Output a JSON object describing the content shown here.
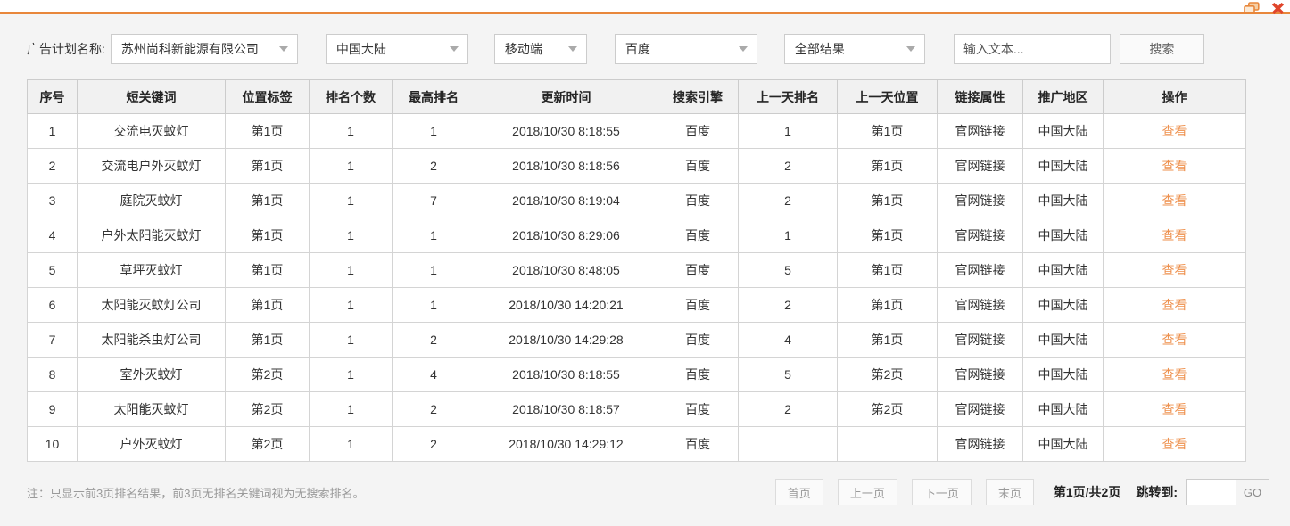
{
  "window": {
    "restore_icon": "restore-window",
    "close_icon": "close-window"
  },
  "filters": {
    "label": "广告计划名称:",
    "dropdowns": [
      "苏州尚科新能源有限公司",
      "中国大陆",
      "移动端",
      "百度",
      "全部结果"
    ],
    "search_input_placeholder": "输入文本...",
    "search_button": "搜索"
  },
  "table": {
    "headers": [
      "序号",
      "短关键词",
      "位置标签",
      "排名个数",
      "最高排名",
      "更新时间",
      "搜索引擎",
      "上一天排名",
      "上一天位置",
      "链接属性",
      "推广地区",
      "操作"
    ],
    "rows": [
      [
        "1",
        "交流电灭蚊灯",
        "第1页",
        "1",
        "1",
        "2018/10/30 8:18:55",
        "百度",
        "1",
        "第1页",
        "官网链接",
        "中国大陆",
        "查看"
      ],
      [
        "2",
        "交流电户外灭蚊灯",
        "第1页",
        "1",
        "2",
        "2018/10/30 8:18:56",
        "百度",
        "2",
        "第1页",
        "官网链接",
        "中国大陆",
        "查看"
      ],
      [
        "3",
        "庭院灭蚊灯",
        "第1页",
        "1",
        "7",
        "2018/10/30 8:19:04",
        "百度",
        "2",
        "第1页",
        "官网链接",
        "中国大陆",
        "查看"
      ],
      [
        "4",
        "户外太阳能灭蚊灯",
        "第1页",
        "1",
        "1",
        "2018/10/30 8:29:06",
        "百度",
        "1",
        "第1页",
        "官网链接",
        "中国大陆",
        "查看"
      ],
      [
        "5",
        "草坪灭蚊灯",
        "第1页",
        "1",
        "1",
        "2018/10/30 8:48:05",
        "百度",
        "5",
        "第1页",
        "官网链接",
        "中国大陆",
        "查看"
      ],
      [
        "6",
        "太阳能灭蚊灯公司",
        "第1页",
        "1",
        "1",
        "2018/10/30 14:20:21",
        "百度",
        "2",
        "第1页",
        "官网链接",
        "中国大陆",
        "查看"
      ],
      [
        "7",
        "太阳能杀虫灯公司",
        "第1页",
        "1",
        "2",
        "2018/10/30 14:29:28",
        "百度",
        "4",
        "第1页",
        "官网链接",
        "中国大陆",
        "查看"
      ],
      [
        "8",
        "室外灭蚊灯",
        "第2页",
        "1",
        "4",
        "2018/10/30 8:18:55",
        "百度",
        "5",
        "第2页",
        "官网链接",
        "中国大陆",
        "查看"
      ],
      [
        "9",
        "太阳能灭蚊灯",
        "第2页",
        "1",
        "2",
        "2018/10/30 8:18:57",
        "百度",
        "2",
        "第2页",
        "官网链接",
        "中国大陆",
        "查看"
      ],
      [
        "10",
        "户外灭蚊灯",
        "第2页",
        "1",
        "2",
        "2018/10/30 14:29:12",
        "百度",
        "",
        "",
        "官网链接",
        "中国大陆",
        "查看"
      ]
    ]
  },
  "footer": {
    "note": "注：只显示前3页排名结果，前3页无排名关键词视为无搜索排名。",
    "pagination": {
      "first": "首页",
      "prev": "上一页",
      "next": "下一页",
      "last": "末页",
      "page_info": "第1页/共2页",
      "jump_label": "跳转到:",
      "go_button": "GO"
    }
  },
  "colors": {
    "accent_orange": "#ee8f4b",
    "titlebar_line": "#e8873b",
    "close_red": "#e0452b",
    "header_bg": "#f1f1f1",
    "page_bg": "#f4f4f4"
  }
}
